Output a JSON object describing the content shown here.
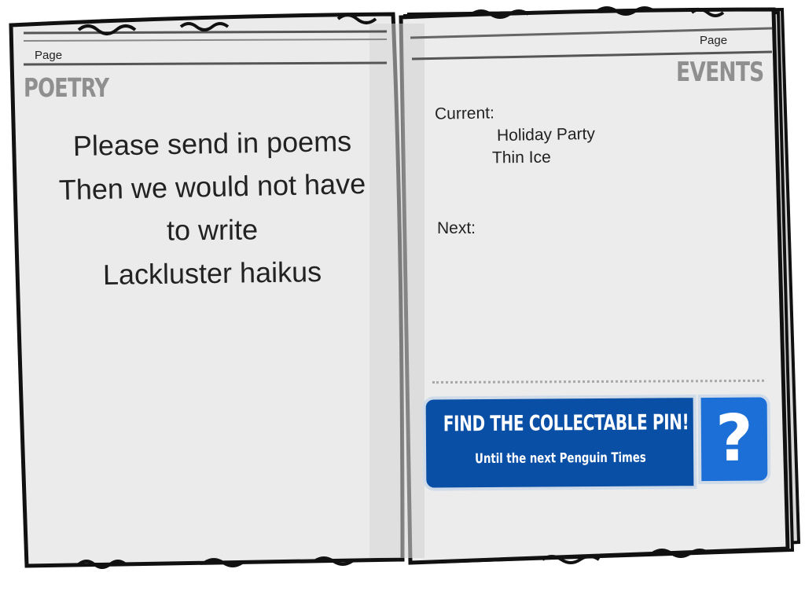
{
  "left_page": {
    "page_label": "Page",
    "section_title": "POETRY",
    "poem_lines": [
      "Please send in poems",
      "Then we would not have",
      "to write",
      "Lackluster haikus"
    ]
  },
  "right_page": {
    "page_label": "Page",
    "section_title": "EVENTS",
    "current_label": "Current:",
    "current_events": [
      "Holiday Party",
      "Thin Ice"
    ],
    "next_label": "Next:"
  },
  "pin_banner": {
    "title": "FIND THE COLLECTABLE PIN!",
    "subtitle": "Until the next Penguin Times",
    "icon": "question-mark-icon",
    "icon_glyph": "?",
    "colors": {
      "main": "#0a4fa6",
      "icon_box": "#1c6fd6"
    }
  }
}
